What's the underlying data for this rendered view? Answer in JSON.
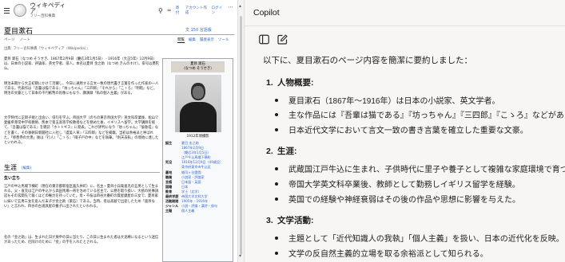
{
  "wikipedia": {
    "site_name": "ウィキペディア",
    "site_tagline": "フリー百科事典",
    "top_links": [
      "寄付",
      "アカウント作成",
      "ログイン"
    ],
    "title": "夏目漱石",
    "languages": "150 言語版",
    "tabs_left": [
      "ページ",
      "ノート"
    ],
    "tabs_right": [
      "閲覧",
      "編集",
      "履歴表示",
      "ツール"
    ],
    "subtitle": "出典: フリー百科事典『ウィキペディア（Wikipedia）』",
    "lead_1": "夏目 漱石（なつめ そうせき、1867年2月9日〈慶応3年1月5日〉 - 1916年〈大正5年〉12月9日）は、日本の小説家、評論家、英文学者、俳人。本名は夏目 金之助（なつめ きんのすけ）。俳号は愚陀仏。",
    "lead_2": "明治末期から大正初期にかけて活躍し、今日に通用する言文一致の現代書き言葉を作った作家の一人である。代表作は『吾輩は猫である』『坊っちゃん』『三四郎』『それから』『こゝろ』『明暗』など。明治の文豪として日本の千円紙幣の肖像にもなり、講演録「私の個人主義」がある。",
    "lead_3": "大学時代に正岡子規と出会い、俳句を学ぶ。帝国大学（のちの東京帝国大学）英文科卒業後、松山で愛媛県尋常中学校教師、熊本で第五高等学校教授などを務めた後、イギリスへ留学。大学講師を経て、『吾輩は猫である』を雑誌『ホトトギス』に発表。これが評判になり『坊っちゃん』『倫敦塔』などを書く。その後朝日新聞社に入社し『虞美人草』『三四郎』などを掲載。当初は余裕派と呼ばれた。「修善寺の大患」後は『行人』『こゝろ』『硝子戸の中』などを執筆。「則天去私」の境地に達したといわれる。",
    "section_title": "生涯",
    "section_edit": "[編集]",
    "sub_heading": "生い立ち",
    "body_1": "江戸の牛込馬場下横町（現在の東京都新宿区喜久井町）に、名主・夏目小兵衛直克の五男として生まれる。父・直克は江戸の牛込から高田馬場一帯を治めている名主で、公務を取り扱い、大抵の民事訴訟もその玄関先で裁くほどの権力を持っていた。母・千枝は四谷大番町の質屋鍵屋の三女で、夏目家に嫁いで五男三女を産んだ末子が金之助（漱石）である。当時、母は高齢で出産したため「面目ない」と言われ、四谷の古道具屋の養子に出されたといわれる。",
    "body_2": "名の「金之助」は、生まれた日が庚申の日に当たり、この日に生まれた者は大泥棒になるという迷信があったため、厄除けのために「金」の字を入れたとされる。",
    "infobox_head_1": "夏目 漱石",
    "infobox_head_2": "（なつめ そうせき）",
    "infobox_caption": "1912年頃撮影",
    "infobox_rows": [
      {
        "k": "誕生",
        "v": "夏目 金之助"
      },
      {
        "k": "",
        "v": "1867年2月9日"
      },
      {
        "k": "",
        "v": "（慶応3年1月5日）"
      },
      {
        "k": "",
        "v": "江戸牛込馬場下横町"
      },
      {
        "k": "死没",
        "v": "1916年12月9日（49歳没）"
      },
      {
        "k": "",
        "v": "東京府東京市牛込区"
      },
      {
        "k": "墓地",
        "v": "雑司ヶ谷霊園"
      },
      {
        "k": "職業",
        "v": "小説家・評論家"
      },
      {
        "k": "言語",
        "v": "日本語・英語"
      },
      {
        "k": "国籍",
        "v": "日本"
      },
      {
        "k": "教育",
        "v": "学士（文学）"
      },
      {
        "k": "最終学歴",
        "v": "帝国大学文科大学"
      },
      {
        "k": "活動期間",
        "v": "1905年 - 1916年"
      },
      {
        "k": "ジャンル",
        "v": "小説・評論・漢詩・俳句"
      },
      {
        "k": "主題",
        "v": "個人主義"
      }
    ]
  },
  "copilot": {
    "title": "Copilot",
    "intro": "以下に、夏目漱石のページ内容を簡潔に要約しました：",
    "sections": [
      {
        "num": "1.",
        "heading": "人物概要:",
        "bullets": [
          "夏目漱石（1867年〜1916年）は日本の小説家、英文学者。",
          "主な作品には『吾輩は猫である』『坊っちゃん』『三四郎』『こゝろ』などがある。",
          "日本近代文学において言文一致の書き言葉を確立した重要な文豪。"
        ]
      },
      {
        "num": "2.",
        "heading": "生涯:",
        "bullets": [
          "武蔵国江戸牛込に生まれ、子供時代に里子や養子として複雑な家庭環境で育つ。",
          "帝国大学英文科卒業後、教師として勤務しイギリス留学を経験。",
          "英国での経験や神経衰弱はその後の作品や思想に影響を与えた。"
        ]
      },
      {
        "num": "3.",
        "heading": "文学活動:",
        "bullets": [
          "主題として「近代知識人の我執」「個人主義」を扱い、日本の近代化を反映。",
          "文学の反自然主義的立場を取る余裕派として知られる。"
        ]
      }
    ]
  }
}
